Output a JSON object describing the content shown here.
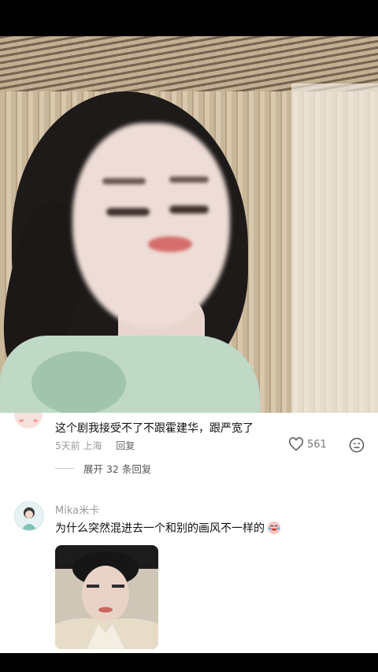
{
  "comments": [
    {
      "text": "这个剧我接受不了不跟霍建华，跟严宽了",
      "time_location": "5天前 上海",
      "reply_label": "回复",
      "likes": "561",
      "expand_replies": "展开 32 条回复"
    },
    {
      "username": "Mika米卡",
      "text": "为什么突然混进去一个和别的画风不一样的"
    }
  ],
  "icons": {
    "like": "heart-outline-icon",
    "reaction": "emoji-face-icon",
    "inline_emoji": "crying-laughing-emoji"
  },
  "colors": {
    "sheet_bg": "#ffffff",
    "secondary_text": "#9a9a9a",
    "primary_text": "#111111"
  }
}
